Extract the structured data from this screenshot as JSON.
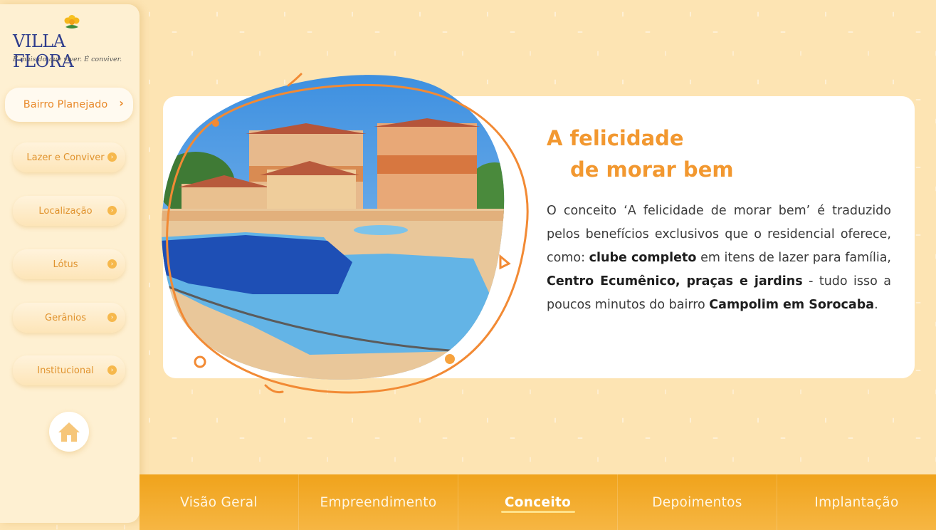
{
  "brand": {
    "name": "VILLA FLORA",
    "tagline": "É mais do que viver. É conviver."
  },
  "sidebar": {
    "items": [
      {
        "label": "Bairro Planejado",
        "active": true
      },
      {
        "label": "Lazer e Conviver"
      },
      {
        "label": "Localização"
      },
      {
        "label": "Lótus"
      },
      {
        "label": "Gerânios"
      },
      {
        "label": "Institucional"
      }
    ],
    "home_icon": "home-icon"
  },
  "content": {
    "title_line1": "A felicidade",
    "title_line2": "de morar bem",
    "body": {
      "p1": "O conceito ‘A felicidade de morar bem’ é traduzido pelos benefícios exclusivos que o residencial oferece, como: ",
      "b1": "clube completo",
      "p2": " em itens de lazer para família, ",
      "b2": "Centro Ecumênico, praças e jardins",
      "p3": " - tudo isso a poucos minutos do bairro ",
      "b3": "Campolim em Sorocaba",
      "p4": "."
    }
  },
  "tabs": [
    {
      "label": "Visão Geral"
    },
    {
      "label": "Empreendimento"
    },
    {
      "label": "Conceito",
      "active": true
    },
    {
      "label": "Depoimentos"
    },
    {
      "label": "Implantação"
    }
  ],
  "colors": {
    "accent": "#f29830",
    "brand_blue": "#2e3c8c",
    "tabbar": "#f0a31b",
    "background": "#fde4b3"
  }
}
